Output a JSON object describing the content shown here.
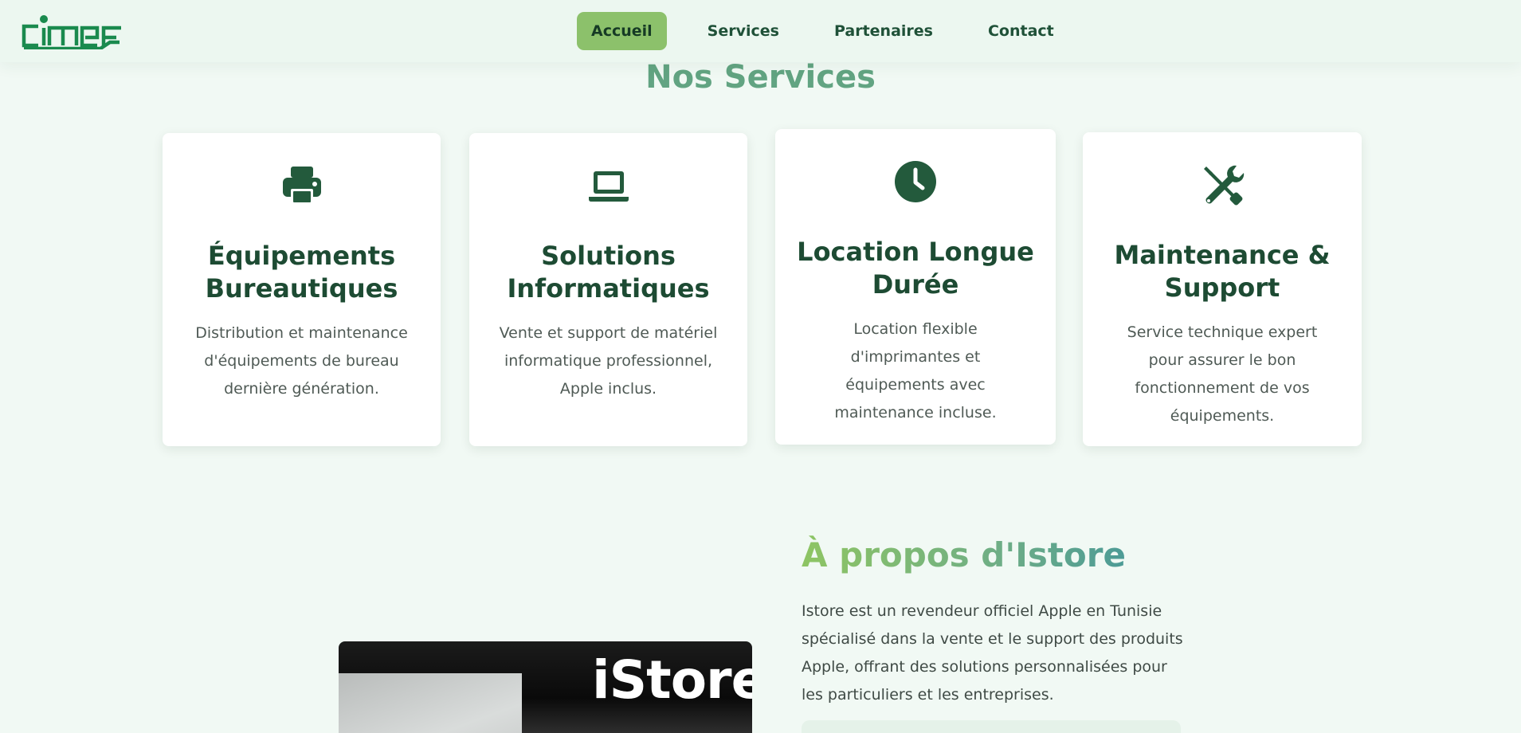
{
  "brand": {
    "logo_text": "cimef",
    "color": "#1a8a4e"
  },
  "nav": {
    "items": [
      {
        "label": "Accueil",
        "active": true
      },
      {
        "label": "Services",
        "active": false
      },
      {
        "label": "Partenaires",
        "active": false
      },
      {
        "label": "Contact",
        "active": false
      }
    ]
  },
  "services": {
    "title": "Nos Services",
    "cards": [
      {
        "icon": "printer-icon",
        "title": "Équipements Bureautiques",
        "description": "Distribution et maintenance d'équipements de bureau dernière génération."
      },
      {
        "icon": "laptop-icon",
        "title": "Solutions Informatiques",
        "description": "Vente et support de matériel informatique professionnel, Apple inclus."
      },
      {
        "icon": "clock-icon",
        "title": "Location Longue Durée",
        "description": "Location flexible d'imprimantes et équipements avec maintenance incluse."
      },
      {
        "icon": "tools-icon",
        "title": "Maintenance & Support",
        "description": "Service technique expert pour assurer le bon fonctionnement de vos équipements."
      }
    ]
  },
  "about": {
    "title": "À propos d'Istore",
    "text": "Istore est un revendeur officiel Apple en Tunisie spécialisé dans la vente et le support des produits Apple, offrant des solutions personnalisées pour les particuliers et les entreprises.",
    "photo_logo": "iStore"
  },
  "colors": {
    "icon": "#235a3c",
    "heading": "#1d4b33",
    "section_title": "#62a482",
    "nav_active": "#8cc16b"
  }
}
